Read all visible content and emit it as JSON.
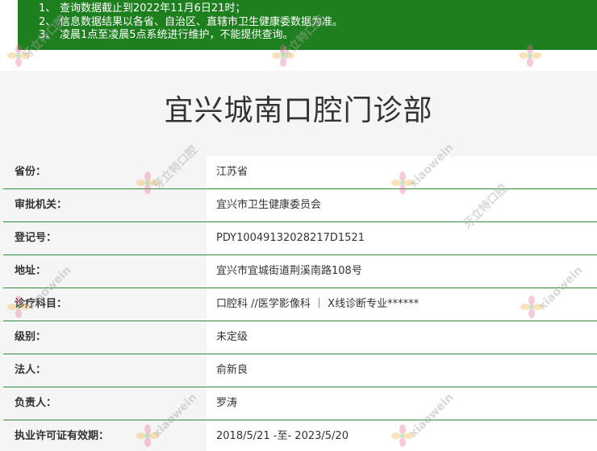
{
  "notice": {
    "items": [
      {
        "num": "1、",
        "text": "查询数据截止到2022年11月6日21时；"
      },
      {
        "num": "2、",
        "text": "信息数据结果以各省、自治区、直辖市卫生健康委数据为准。"
      },
      {
        "num": "3、",
        "text": "凌晨1点至凌晨5点系统进行维护，不能提供查询。"
      }
    ]
  },
  "title": "宜兴城南口腔门诊部",
  "rows": [
    {
      "label": "省份：",
      "value": "江苏省"
    },
    {
      "label": "审批机关：",
      "value": "宜兴市卫生健康委员会"
    },
    {
      "label": "登记号：",
      "value": "PDY10049132028217D1521"
    },
    {
      "label": "地址：",
      "value": "宜兴市宜城街道荆溪南路108号"
    },
    {
      "label": "诊疗科目：",
      "value": "口腔科 //医学影像科 ｜ X线诊断专业******"
    },
    {
      "label": "级别：",
      "value": "未定级"
    },
    {
      "label": "法人：",
      "value": "俞新良"
    },
    {
      "label": "负责人：",
      "value": "罗涛"
    },
    {
      "label": "执业许可证有效期：",
      "value": "2018/5/21 -至- 2023/5/20"
    }
  ],
  "watermark": {
    "text": "xiaowein",
    "logo_text": "牙立特口腔"
  },
  "colors": {
    "notice_bg": "#1e7f1e",
    "row_divider": "#2d8a3e",
    "card_bg": "#f5f5f5"
  }
}
